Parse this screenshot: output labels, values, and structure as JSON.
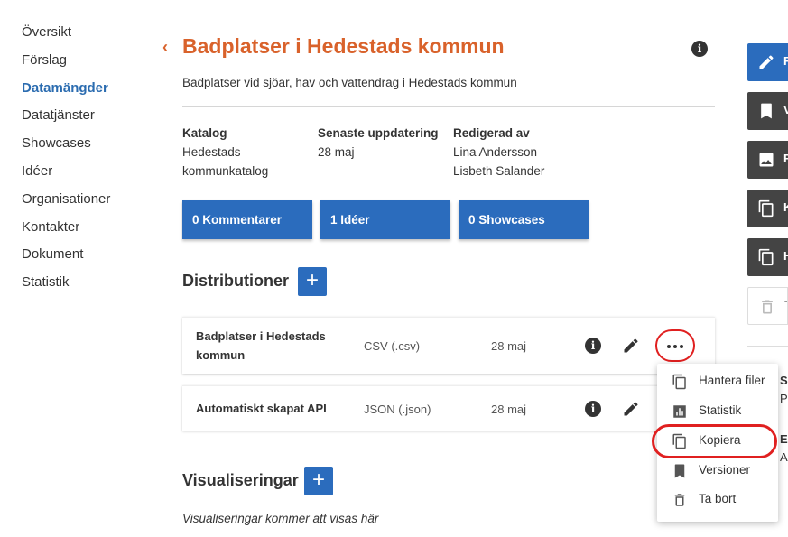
{
  "nav": {
    "items": [
      "Översikt",
      "Förslag",
      "Datamängder",
      "Datatjänster",
      "Showcases",
      "Idéer",
      "Organisationer",
      "Kontakter",
      "Dokument",
      "Statistik"
    ],
    "active_index": 2
  },
  "header": {
    "back": "‹",
    "title": "Badplatser i Hedestads kommun",
    "info": "i",
    "description": "Badplatser vid sjöar, hav och vattendrag i Hedestads kommun"
  },
  "meta": {
    "catalog_label": "Katalog",
    "catalog_line1": "Hedestads",
    "catalog_line2": "kommunkatalog",
    "updated_label": "Senaste uppdatering",
    "updated_value": "28 maj",
    "edited_label": "Redigerad av",
    "edited_line1": "Lina Andersson",
    "edited_line2": "Lisbeth Salander"
  },
  "stats": {
    "comments": "0 Kommentarer",
    "ideas": "1 Idéer",
    "showcases": "0 Showcases"
  },
  "distributions": {
    "title": "Distributioner",
    "add": "+",
    "rows": [
      {
        "name_line1": "Badplatser i Hedestads",
        "name_line2": "kommun",
        "format": "CSV (.csv)",
        "date": "28 maj"
      },
      {
        "name_line1": "Automatiskt skapat API",
        "name_line2": "",
        "format": "JSON (.json)",
        "date": "28 maj"
      }
    ]
  },
  "menu": {
    "items": [
      {
        "label": "Hantera filer",
        "icon": "files-icon"
      },
      {
        "label": "Statistik",
        "icon": "bar-chart-icon"
      },
      {
        "label": "Kopiera",
        "icon": "copy-icon"
      },
      {
        "label": "Versioner",
        "icon": "bookmark-icon"
      },
      {
        "label": "Ta bort",
        "icon": "trash-icon"
      }
    ]
  },
  "visualizations": {
    "title": "Visualiseringar",
    "add": "+",
    "empty": "Visualiseringar kommer att visas här"
  },
  "right_panel": {
    "buttons": [
      {
        "label": "R",
        "icon": "pencil-icon"
      },
      {
        "label": "V",
        "icon": "bookmark-icon"
      },
      {
        "label": "F",
        "icon": "image-icon"
      },
      {
        "label": "K",
        "icon": "copy-icon"
      },
      {
        "label": "H",
        "icon": "files-icon"
      },
      {
        "label": "T",
        "icon": "trash-icon"
      }
    ],
    "text1": "S",
    "text2": "P",
    "text3": "E",
    "text4": "A"
  },
  "colors": {
    "accent": "#2b6cbd",
    "title": "#d9622b",
    "highlight": "#e02020"
  }
}
